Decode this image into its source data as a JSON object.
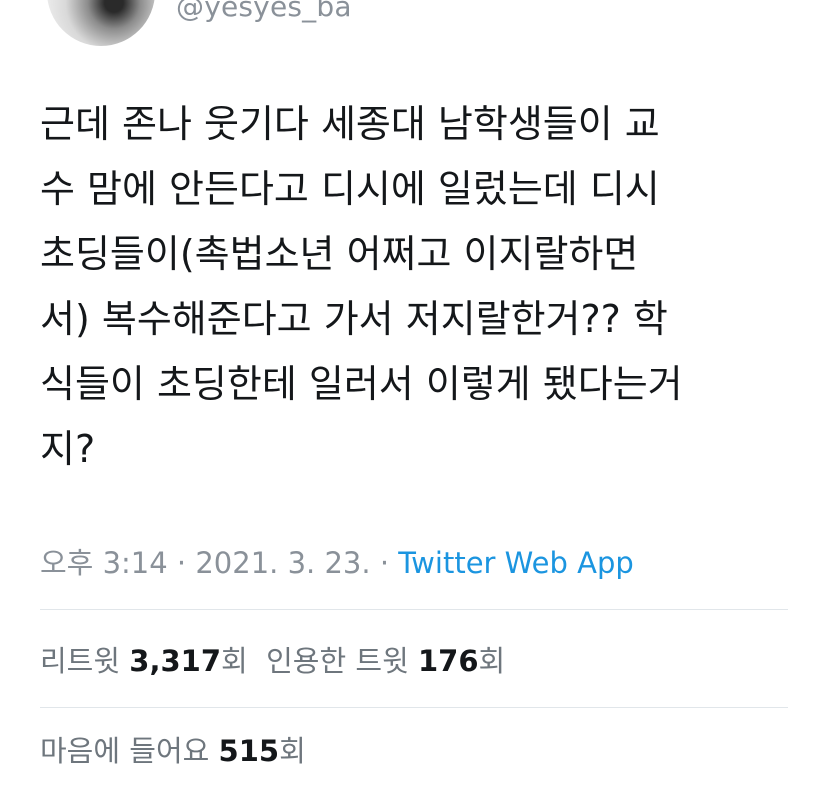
{
  "author": {
    "handle": "@yesyes_ba",
    "avatar_icon": "profile-avatar"
  },
  "tweet": {
    "text": "근데 존나 웃기다 세종대 남학생들이 교\n수 맘에 안든다고 디시에 일렀는데 디시\n초딩들이(촉법소년 어쩌고 이지랄하면\n서) 복수해준다고 가서 저지랄한거?? 학\n식들이 초딩한테 일러서 이렇게 됐다는거\n지?"
  },
  "meta": {
    "time": "오후 3:14",
    "sep1": " · ",
    "date": "2021. 3. 23.",
    "sep2": " · ",
    "source": "Twitter Web App"
  },
  "stats": {
    "retweets_label": "리트윗 ",
    "retweets_count": "3,317",
    "retweets_unit": "회",
    "quotes_label": "인용한 트윗 ",
    "quotes_count": "176",
    "quotes_unit": "회",
    "likes_label": "마음에 들어요 ",
    "likes_count": "515",
    "likes_unit": "회"
  },
  "colors": {
    "link": "#1b95e0",
    "muted": "#8a9199",
    "text": "#14171a",
    "divider": "#e1e6ea"
  }
}
